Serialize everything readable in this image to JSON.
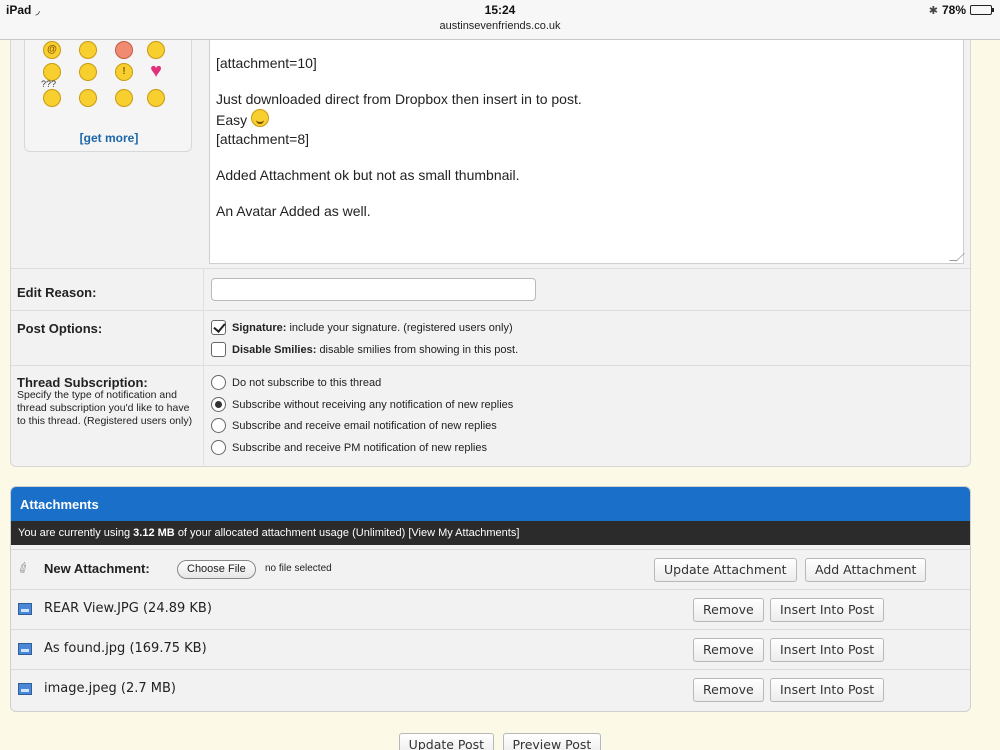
{
  "status_bar": {
    "device": "iPad",
    "time": "15:24",
    "url": "austinsevenfriends.co.uk",
    "battery": "78%",
    "battery_level": 0.78
  },
  "smilies": {
    "get_more_label": "[get more]",
    "question_label": "???"
  },
  "editor": {
    "lines": [
      "[attachment=10]",
      "Just  downloaded direct from Dropbox then insert in to post.",
      "Easy",
      "[attachment=8]",
      "Added Attachment ok but not as small thumbnail.",
      "An Avatar Added as well."
    ]
  },
  "edit_reason": {
    "label": "Edit Reason:",
    "value": ""
  },
  "post_options": {
    "label": "Post Options:",
    "signature_title": "Signature:",
    "signature_desc": "include your signature. (registered users only)",
    "signature_checked": true,
    "smilies_title": "Disable Smilies:",
    "smilies_desc": "disable smilies from showing in this post.",
    "smilies_checked": false
  },
  "subscription": {
    "label": "Thread Subscription:",
    "description": "Specify the type of notification and thread subscription you'd like to have to this thread. (Registered users only)",
    "options": [
      "Do not subscribe to this thread",
      "Subscribe without receiving any notification of new replies",
      "Subscribe and receive email notification of new replies",
      "Subscribe and receive PM notification of new replies"
    ],
    "selected_index": 1
  },
  "attachments": {
    "title": "Attachments",
    "usage_prefix": "You are currently using",
    "usage_amount": "3.12 MB",
    "usage_suffix": "of your allocated attachment usage (Unlimited) [View My Attachments]",
    "new_label": "New Attachment:",
    "choose_file": "Choose File",
    "no_file": "no file selected",
    "update_btn": "Update Attachment",
    "add_btn": "Add Attachment",
    "remove_label": "Remove",
    "insert_label": "Insert Into Post",
    "files": [
      "REAR View.JPG (24.89 KB)",
      "As found.jpg (169.75 KB)",
      "image.jpeg (2.7 MB)"
    ]
  },
  "actions": {
    "update_post": "Update Post",
    "preview_post": "Preview Post"
  }
}
